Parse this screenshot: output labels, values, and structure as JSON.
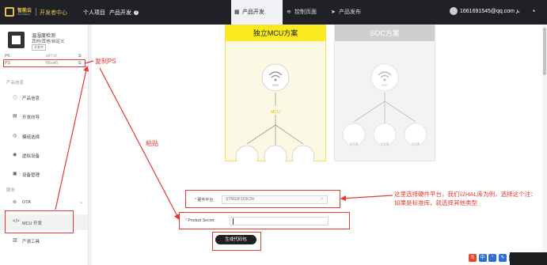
{
  "topbar": {
    "brand": "智能云",
    "brand_sub": "AI-Cloud",
    "dev_center": "开发者中心",
    "nav": [
      "个人项目",
      "产品开发"
    ],
    "tabs": [
      {
        "label": "产品开发",
        "icon": "grid-icon"
      },
      {
        "label": "控制页面",
        "icon": "wifi-icon"
      },
      {
        "label": "产品发布",
        "icon": "send-icon"
      }
    ],
    "user_email": "1661691545@qq.com",
    "user_caret": "⌄"
  },
  "sidebar": {
    "device_name": "温湿度检测",
    "device_category": "其他/其他/自定义",
    "device_tag": "开发中",
    "pk_label": "PK:",
    "pk_value": "a47c9",
    "ps_label": "PS:",
    "ps_value": "f6ba45",
    "section_product": "产品信息",
    "section_service": "服务",
    "items": [
      {
        "label": "产品信息",
        "icon": "info-icon"
      },
      {
        "label": "开发向导",
        "icon": "guide-icon"
      },
      {
        "label": "模组选择",
        "icon": "module-icon"
      },
      {
        "label": "虚拟设备",
        "icon": "virtual-device-icon"
      },
      {
        "label": "设备管理",
        "icon": "device-icon"
      },
      {
        "label": "OTA",
        "icon": "ota-icon"
      },
      {
        "label": "MCU 开发",
        "icon": "code-icon"
      },
      {
        "label": "产测工具",
        "icon": "tool-icon"
      }
    ]
  },
  "main": {
    "card_mcu": {
      "title": "独立MCU方案",
      "wifi_label": "WiFi",
      "mcu_label": "MCU",
      "sensor_label": "传感器"
    },
    "card_soc": {
      "title": "SOC方案",
      "wifi_label": "WiFi",
      "sensor_label": "传感器"
    },
    "form": {
      "platform_label": "硬件平台:",
      "platform_value": "STM32F103C8x",
      "secret_label": "Product Secret:",
      "secret_value": "",
      "generate_label": "生成代码包"
    }
  },
  "annotations": {
    "copy_ps": "复制PS",
    "paste": "粘贴",
    "note": "这里选择硬件平台，我们以HAL库为例，选择这个注：如果是标准库，就选择其他类型"
  },
  "tray": {
    "s_badge": "S",
    "items": [
      "中",
      "°",
      "✎",
      "♫"
    ]
  },
  "colors": {
    "accent": "#fbe91f",
    "annotation": "#e53935",
    "topbar": "#1f2127"
  }
}
